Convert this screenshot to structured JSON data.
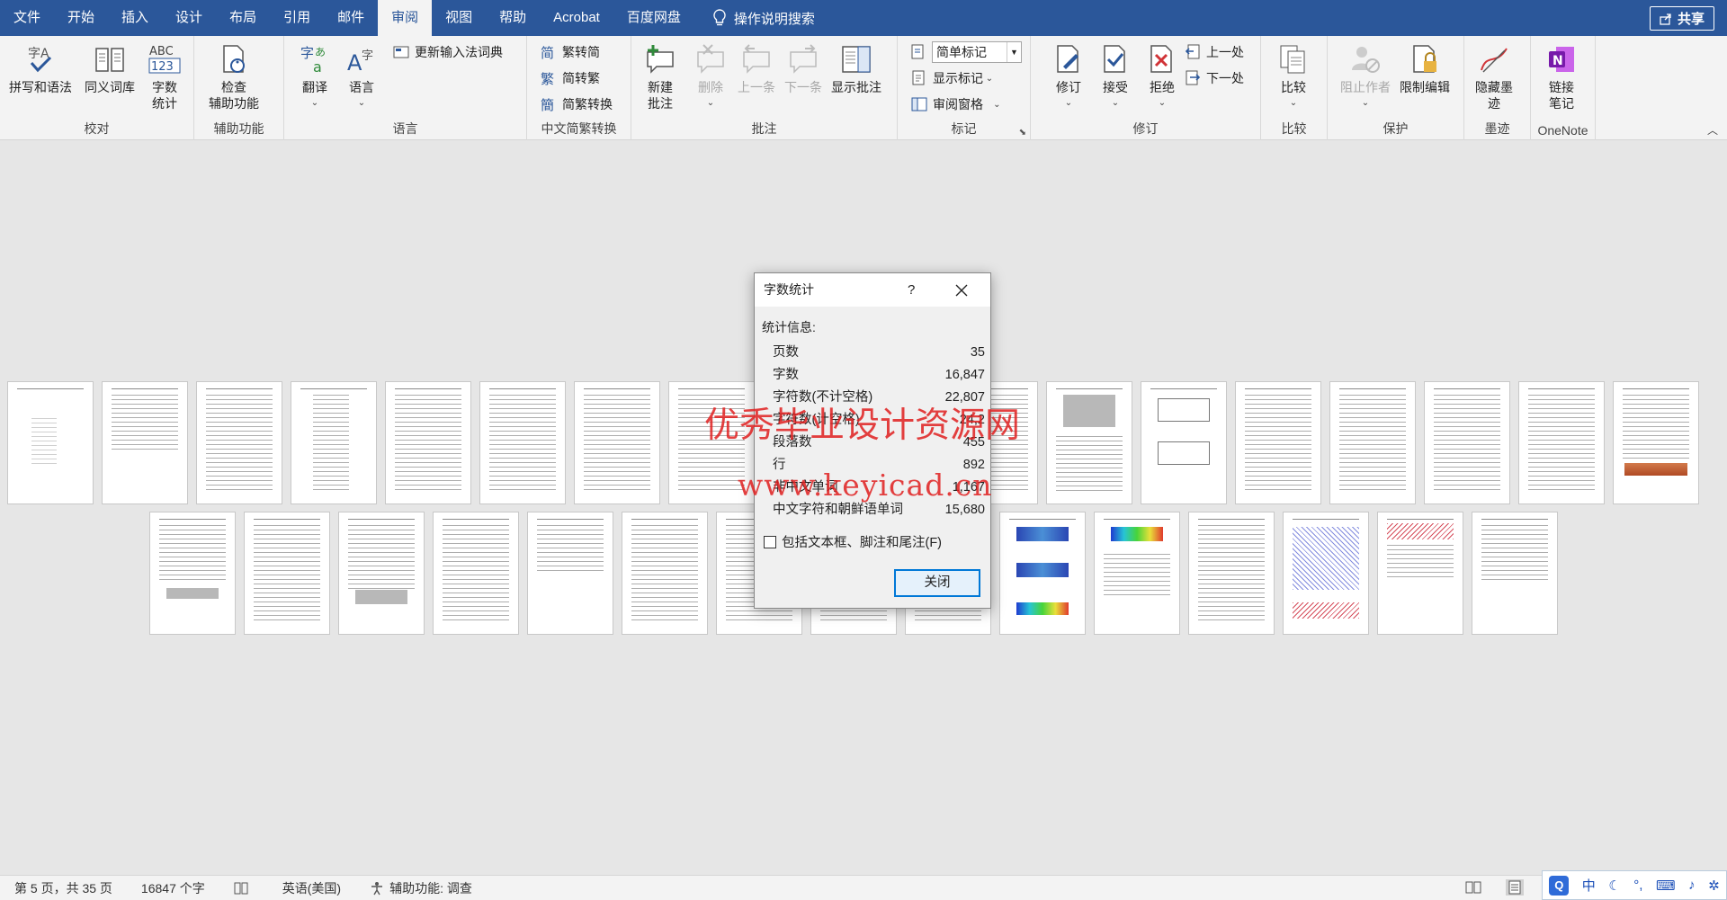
{
  "menu": {
    "items": [
      "文件",
      "开始",
      "插入",
      "设计",
      "布局",
      "引用",
      "邮件",
      "审阅",
      "视图",
      "帮助",
      "Acrobat",
      "百度网盘"
    ],
    "active_index": 7,
    "tellme": "操作说明搜索",
    "share": "共享"
  },
  "ribbon": {
    "groups": {
      "proofing": "校对",
      "accessibility": "辅助功能",
      "language": "语言",
      "chinese_conversion": "中文简繁转换",
      "comments": "批注",
      "tracking": "标记",
      "changes": "修订",
      "compare": "比较",
      "protect": "保护",
      "ink": "墨迹",
      "onenote": "OneNote"
    },
    "buttons": {
      "spelling": "拼写和语法",
      "thesaurus": "同义词库",
      "wordcount": "字数\n统计",
      "check_access": "检查\n辅助功能",
      "translate": "翻译",
      "language": "语言",
      "update_ime": "更新输入法词典",
      "trad_to_simp": "繁转简",
      "simp_to_trad": "简转繁",
      "convert": "简繁转换",
      "new_comment": "新建\n批注",
      "delete": "删除",
      "previous": "上一条",
      "next": "下一条",
      "show_comments": "显示批注",
      "markup_select": "简单标记",
      "show_markup": "显示标记",
      "review_pane": "审阅窗格",
      "track": "修订",
      "accept": "接受",
      "reject": "拒绝",
      "prev_change": "上一处",
      "next_change": "下一处",
      "compare": "比较",
      "block_authors": "阻止作者",
      "restrict": "限制编辑",
      "hide_ink": "隐藏墨\n迹",
      "linked_notes": "链接\n笔记"
    }
  },
  "dialog": {
    "title": "字数统计",
    "help": "?",
    "stats_label": "统计信息:",
    "stats": [
      {
        "label": "页数",
        "value": "35"
      },
      {
        "label": "字数",
        "value": "16,847"
      },
      {
        "label": "字符数(不计空格)",
        "value": "22,807"
      },
      {
        "label": "字符数(计空格)",
        "value": "24,2"
      },
      {
        "label": "段落数",
        "value": "455"
      },
      {
        "label": "行",
        "value": "892"
      },
      {
        "label": "非中文单词",
        "value": "1,167"
      },
      {
        "label": "中文字符和朝鲜语单词",
        "value": "15,680"
      }
    ],
    "checkbox_label": "包括文本框、脚注和尾注(F)",
    "close_button": "关闭"
  },
  "watermark": {
    "line1": "优秀毕业设计资源网",
    "line2": "www.keyicad.cn"
  },
  "status": {
    "page": "第 5 页，共 35 页",
    "words": "16847 个字",
    "language": "英语(美国)",
    "accessibility": "辅助功能: 调查"
  },
  "ime": {
    "lang": "中"
  },
  "colors": {
    "title_bar": "#2b579a",
    "accent": "#0078d7",
    "watermark": "#e02020"
  }
}
